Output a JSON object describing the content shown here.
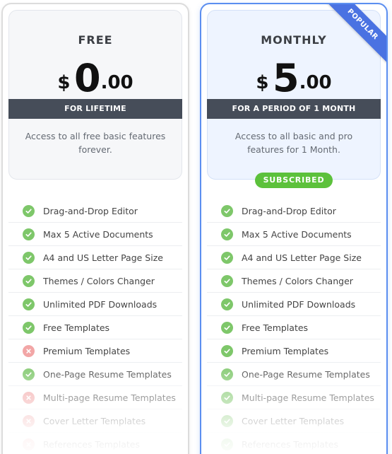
{
  "plans": [
    {
      "name": "FREE",
      "currency": "$",
      "price_whole": "0",
      "price_cents": ".00",
      "period": "FOR LIFETIME",
      "description": "Access to all free basic features forever.",
      "features": [
        {
          "label": "Drag-and-Drop Editor",
          "included": true
        },
        {
          "label": "Max 5 Active Documents",
          "included": true
        },
        {
          "label": "A4 and US Letter Page Size",
          "included": true
        },
        {
          "label": "Themes / Colors Changer",
          "included": true
        },
        {
          "label": "Unlimited PDF Downloads",
          "included": true
        },
        {
          "label": "Free Templates",
          "included": true
        },
        {
          "label": "Premium Templates",
          "included": false
        },
        {
          "label": "One-Page Resume Templates",
          "included": true
        },
        {
          "label": "Multi-page Resume Templates",
          "included": false
        },
        {
          "label": "Cover Letter Templates",
          "included": false
        },
        {
          "label": "References Templates",
          "included": false
        }
      ]
    },
    {
      "name": "MONTHLY",
      "currency": "$",
      "price_whole": "5",
      "price_cents": ".00",
      "period": "FOR A PERIOD OF 1 MONTH",
      "description": "Access to all basic and pro features for 1 Month.",
      "ribbon": "POPULAR",
      "status_badge": "SUBSCRIBED",
      "features": [
        {
          "label": "Drag-and-Drop Editor",
          "included": true
        },
        {
          "label": "Max 5 Active Documents",
          "included": true
        },
        {
          "label": "A4 and US Letter Page Size",
          "included": true
        },
        {
          "label": "Themes / Colors Changer",
          "included": true
        },
        {
          "label": "Unlimited PDF Downloads",
          "included": true
        },
        {
          "label": "Free Templates",
          "included": true
        },
        {
          "label": "Premium Templates",
          "included": true
        },
        {
          "label": "One-Page Resume Templates",
          "included": true
        },
        {
          "label": "Multi-page Resume Templates",
          "included": true
        },
        {
          "label": "Cover Letter Templates",
          "included": true
        },
        {
          "label": "References Templates",
          "included": true
        }
      ]
    }
  ],
  "colors": {
    "accent": "#4a72e2",
    "check": "#7ec76a",
    "cross": "#f2a6a6",
    "band": "#464d59",
    "subscribed": "#5cc13b"
  },
  "icons": {
    "included": "check-circle-icon",
    "excluded": "cross-circle-icon"
  }
}
